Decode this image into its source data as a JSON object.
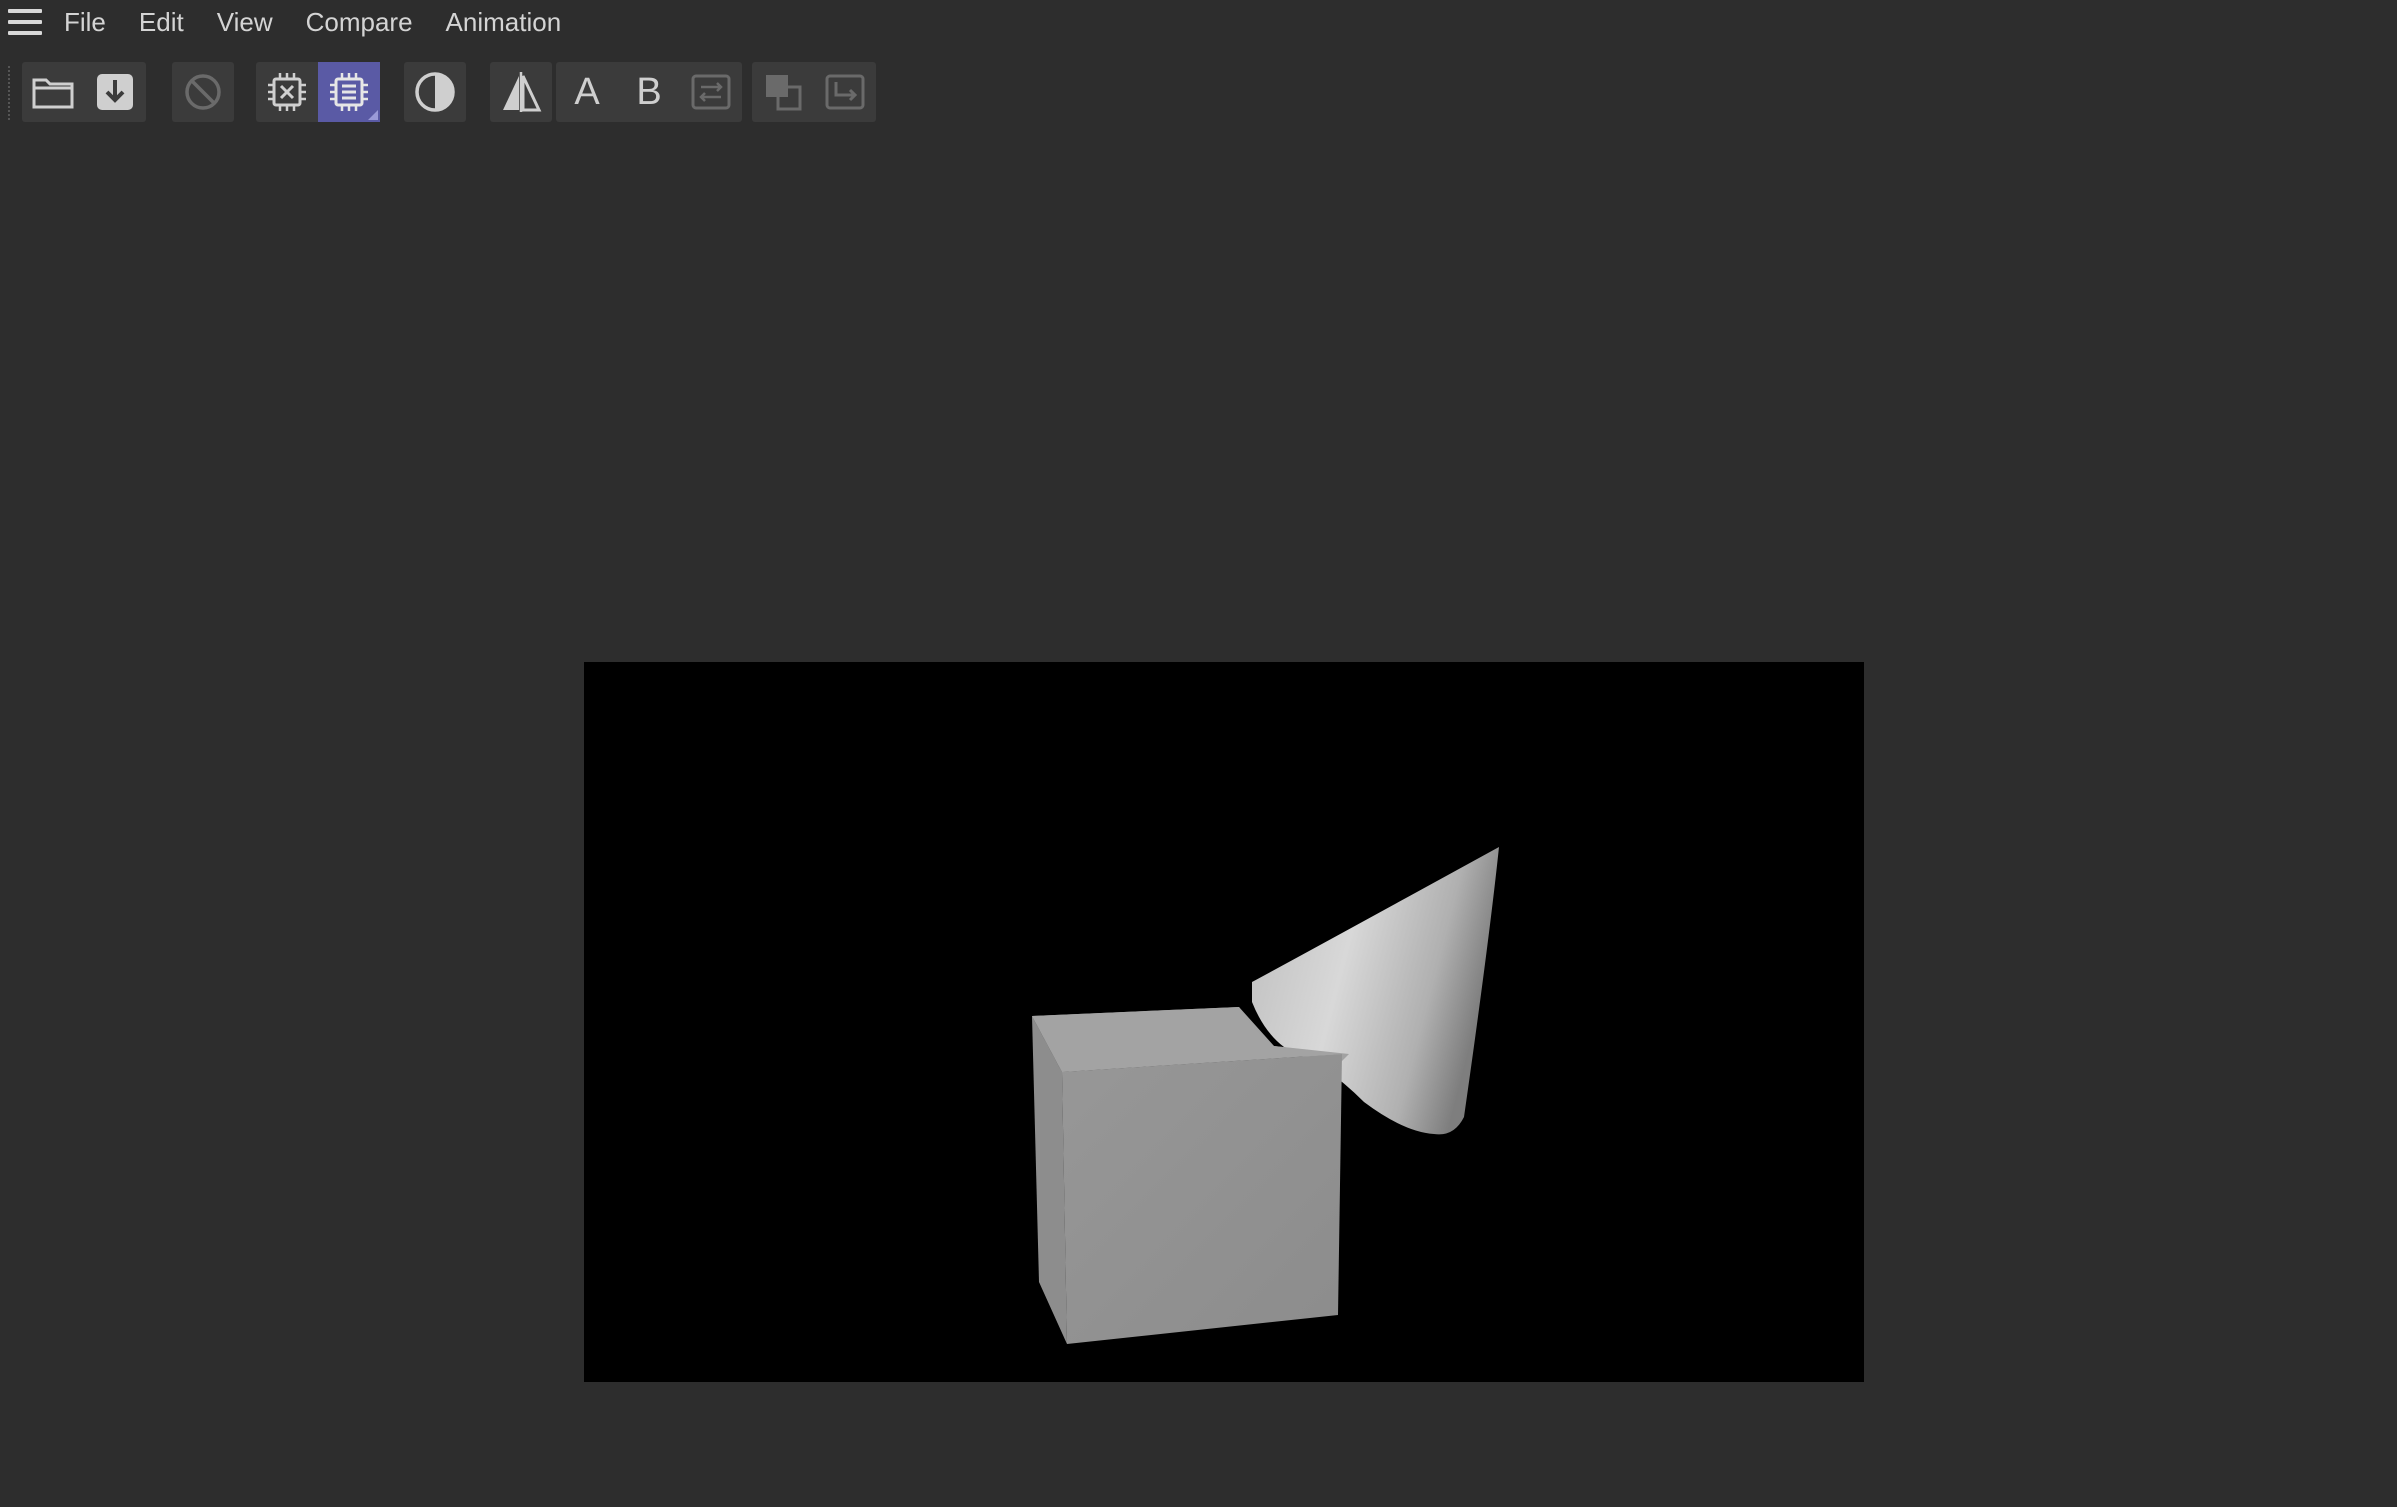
{
  "menubar": {
    "items": [
      {
        "label": "File"
      },
      {
        "label": "Edit"
      },
      {
        "label": "View"
      },
      {
        "label": "Compare"
      },
      {
        "label": "Animation"
      }
    ]
  },
  "toolbar": {
    "buttons": [
      {
        "icon": "open-folder-icon",
        "enabled": true
      },
      {
        "icon": "save-download-icon",
        "enabled": true
      },
      {
        "icon": "stop-icon",
        "enabled": false
      },
      {
        "icon": "cpu-clear-icon",
        "enabled": true
      },
      {
        "icon": "cpu-list-icon",
        "enabled": true,
        "active": true
      },
      {
        "icon": "contrast-icon",
        "enabled": true
      },
      {
        "icon": "flip-compare-icon",
        "enabled": true
      },
      {
        "label": "A",
        "enabled": true
      },
      {
        "label": "B",
        "enabled": true
      },
      {
        "icon": "swap-icon",
        "enabled": false
      },
      {
        "icon": "overlay-icon",
        "enabled": false
      },
      {
        "icon": "export-icon",
        "enabled": false
      }
    ],
    "letter_a": "A",
    "letter_b": "B"
  },
  "viewport": {
    "content": "3D render of a cube and a cone on black background",
    "background": "#000000"
  },
  "colors": {
    "app_background": "#2d2d2d",
    "button_background": "#3b3b3b",
    "active_accent": "#5a5aa5",
    "icon": "#cfcfcf",
    "icon_disabled": "#6a6a6a"
  }
}
